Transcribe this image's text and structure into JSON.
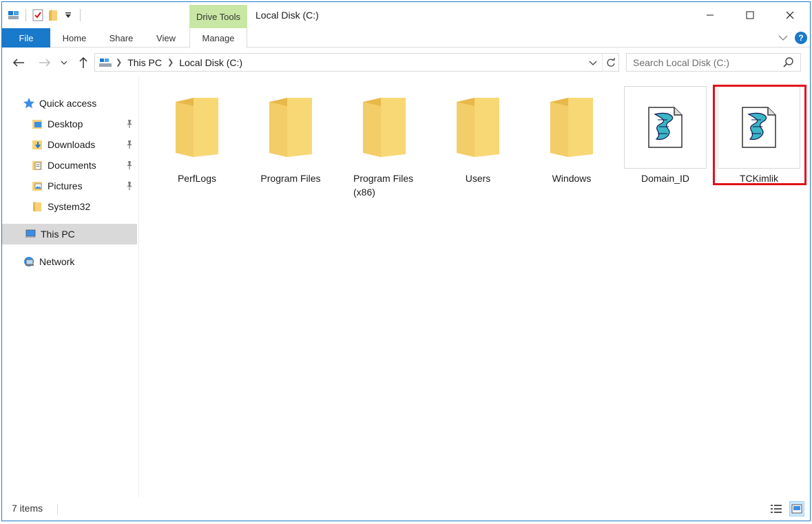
{
  "window": {
    "title": "Local Disk (C:)",
    "contextual_tab_group": "Drive Tools",
    "accent": "#1979ca"
  },
  "ribbon": {
    "tabs": [
      "File",
      "Home",
      "Share",
      "View",
      "Manage"
    ]
  },
  "address": {
    "breadcrumbs": [
      "This PC",
      "Local Disk (C:)"
    ]
  },
  "search": {
    "placeholder": "Search Local Disk (C:)"
  },
  "sidebar": {
    "items": [
      {
        "label": "Quick access",
        "icon": "star-icon"
      },
      {
        "label": "Desktop",
        "icon": "desktop-folder-icon",
        "pinned": true
      },
      {
        "label": "Downloads",
        "icon": "downloads-folder-icon",
        "pinned": true
      },
      {
        "label": "Documents",
        "icon": "documents-folder-icon",
        "pinned": true
      },
      {
        "label": "Pictures",
        "icon": "pictures-folder-icon",
        "pinned": true
      },
      {
        "label": "System32",
        "icon": "folder-icon"
      },
      {
        "label": "This PC",
        "icon": "computer-icon",
        "selected": true
      },
      {
        "label": "Network",
        "icon": "network-icon"
      }
    ]
  },
  "files": [
    {
      "name": "PerfLogs",
      "type": "folder"
    },
    {
      "name": "Program Files",
      "type": "folder"
    },
    {
      "name": "Program Files\n(x86)",
      "type": "folder"
    },
    {
      "name": "Users",
      "type": "folder"
    },
    {
      "name": "Windows",
      "type": "folder"
    },
    {
      "name": "Domain_ID",
      "type": "script"
    },
    {
      "name": "TCKimlik",
      "type": "script",
      "highlighted": true
    }
  ],
  "status": {
    "item_count": "7 items"
  }
}
